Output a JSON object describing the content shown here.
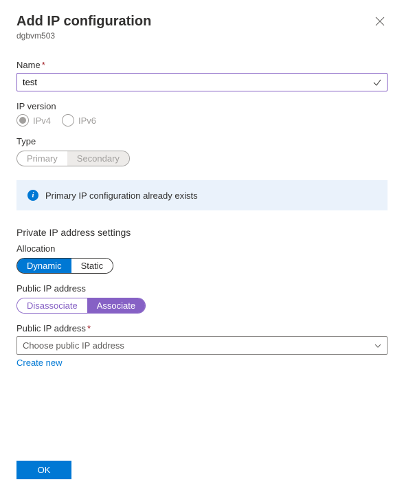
{
  "header": {
    "title": "Add IP configuration",
    "subtitle": "dgbvm503"
  },
  "name": {
    "label": "Name",
    "value": "test"
  },
  "ipversion": {
    "label": "IP version",
    "opt1": "IPv4",
    "opt2": "IPv6"
  },
  "type": {
    "label": "Type",
    "opt1": "Primary",
    "opt2": "Secondary"
  },
  "info": {
    "message": "Primary IP configuration already exists"
  },
  "private": {
    "section": "Private IP address settings",
    "alloc_label": "Allocation",
    "alloc_opt1": "Dynamic",
    "alloc_opt2": "Static"
  },
  "publicip": {
    "label": "Public IP address",
    "opt1": "Disassociate",
    "opt2": "Associate"
  },
  "publicip_select": {
    "label": "Public IP address",
    "placeholder": "Choose public IP address",
    "create": "Create new"
  },
  "footer": {
    "ok": "OK"
  }
}
